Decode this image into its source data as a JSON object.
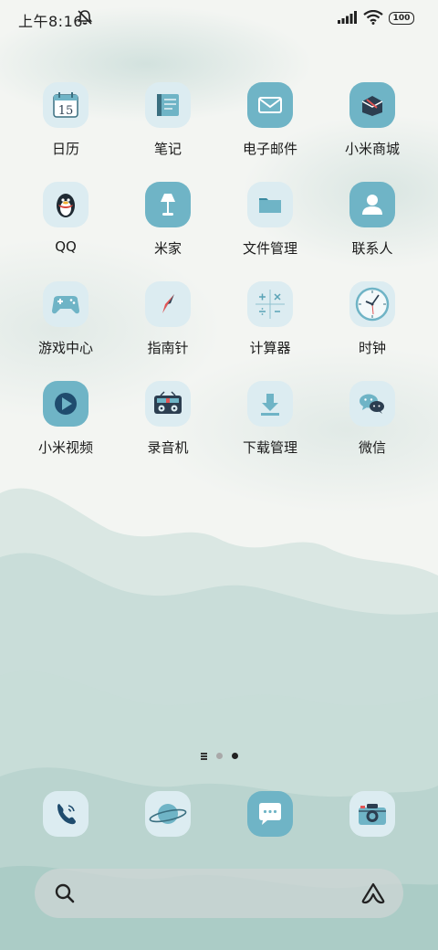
{
  "status_bar": {
    "time": "上午8:16",
    "battery": "100"
  },
  "apps": [
    {
      "label": "日历",
      "icon": "calendar-icon",
      "day": "15"
    },
    {
      "label": "笔记",
      "icon": "notes-icon"
    },
    {
      "label": "电子邮件",
      "icon": "email-icon"
    },
    {
      "label": "小米商城",
      "icon": "mi-store-icon"
    },
    {
      "label": "QQ",
      "icon": "qq-penguin-icon"
    },
    {
      "label": "米家",
      "icon": "mijia-lamp-icon"
    },
    {
      "label": "文件管理",
      "icon": "folder-icon"
    },
    {
      "label": "联系人",
      "icon": "contact-person-icon"
    },
    {
      "label": "游戏中心",
      "icon": "gamepad-icon"
    },
    {
      "label": "指南针",
      "icon": "compass-icon"
    },
    {
      "label": "计算器",
      "icon": "calculator-icon"
    },
    {
      "label": "时钟",
      "icon": "clock-icon"
    },
    {
      "label": "小米视频",
      "icon": "video-play-icon"
    },
    {
      "label": "录音机",
      "icon": "recorder-icon"
    },
    {
      "label": "下载管理",
      "icon": "download-icon"
    },
    {
      "label": "微信",
      "icon": "wechat-icon"
    }
  ],
  "page_indicator": {
    "pages": 2,
    "active": 2
  },
  "dock": [
    {
      "icon": "phone-icon"
    },
    {
      "icon": "browser-planet-icon"
    },
    {
      "icon": "messages-icon"
    },
    {
      "icon": "camera-icon"
    }
  ],
  "colors": {
    "icon_bg": "#dcecf1",
    "icon_accent": "#6fb4c6",
    "dark_accent": "#3a6f80"
  }
}
